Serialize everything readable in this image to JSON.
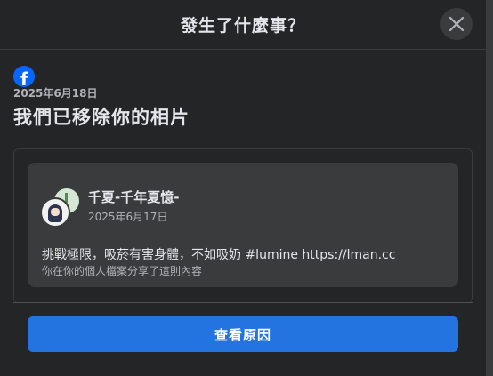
{
  "dialog": {
    "title": "發生了什麼事？",
    "close_icon": "close-icon"
  },
  "notice": {
    "brand_icon": "facebook-logo-icon",
    "date": "2025年6月18日",
    "title": "我們已移除你的相片"
  },
  "post": {
    "author": "千夏-千年夏憶-",
    "date": "2025年6月17日",
    "text": "挑戰極限，吸菸有害身體，不如吸奶 #lumine https://lman.cc",
    "subtext": "你在你的個人檔案分享了這則內容"
  },
  "action": {
    "label": "查看原因"
  },
  "colors": {
    "background": "#242526",
    "card": "#3a3b3c",
    "accent": "#2374e1",
    "facebook_blue": "#0866ff"
  }
}
